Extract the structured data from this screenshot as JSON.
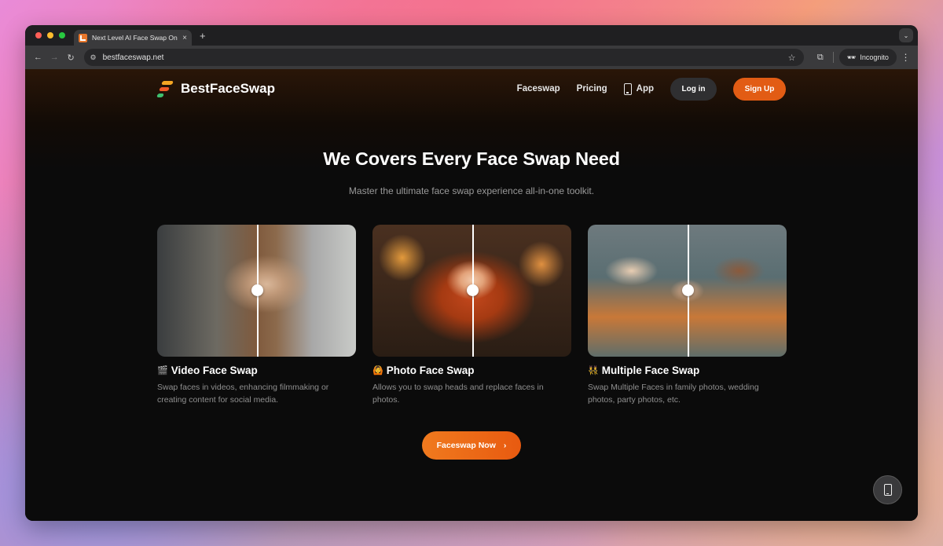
{
  "browser": {
    "tab_title": "Next Level AI Face Swap Onli",
    "tab_close": "×",
    "new_tab": "+",
    "url": "bestfaceswap.net",
    "incognito_label": "Incognito",
    "back_icon": "arrow-left-icon",
    "forward_icon": "arrow-right-icon",
    "reload_icon": "reload-icon"
  },
  "nav": {
    "logo_text": "BestFaceSwap",
    "links": [
      "Faceswap",
      "Pricing"
    ],
    "app_label": "App",
    "login_label": "Log in",
    "signup_label": "Sign Up"
  },
  "hero": {
    "title": "We Covers Every Face Swap Need",
    "subtitle": "Master the ultimate face swap experience all-in-one toolkit."
  },
  "cards": [
    {
      "emoji": "🎬",
      "title": "Video Face Swap",
      "description": "Swap faces in videos, enhancing filmmaking or creating content for social media."
    },
    {
      "emoji": "🙆",
      "title": "Photo Face Swap",
      "description": "Allows you to swap heads and replace faces in photos."
    },
    {
      "emoji": "👯",
      "title": "Multiple Face Swap",
      "description": "Swap Multiple Faces in family photos, wedding photos, party photos, etc."
    }
  ],
  "cta": {
    "label": "Faceswap Now",
    "arrow": "›"
  },
  "colors": {
    "accent": "#e25c14",
    "page_bg": "#0b0b0b"
  }
}
